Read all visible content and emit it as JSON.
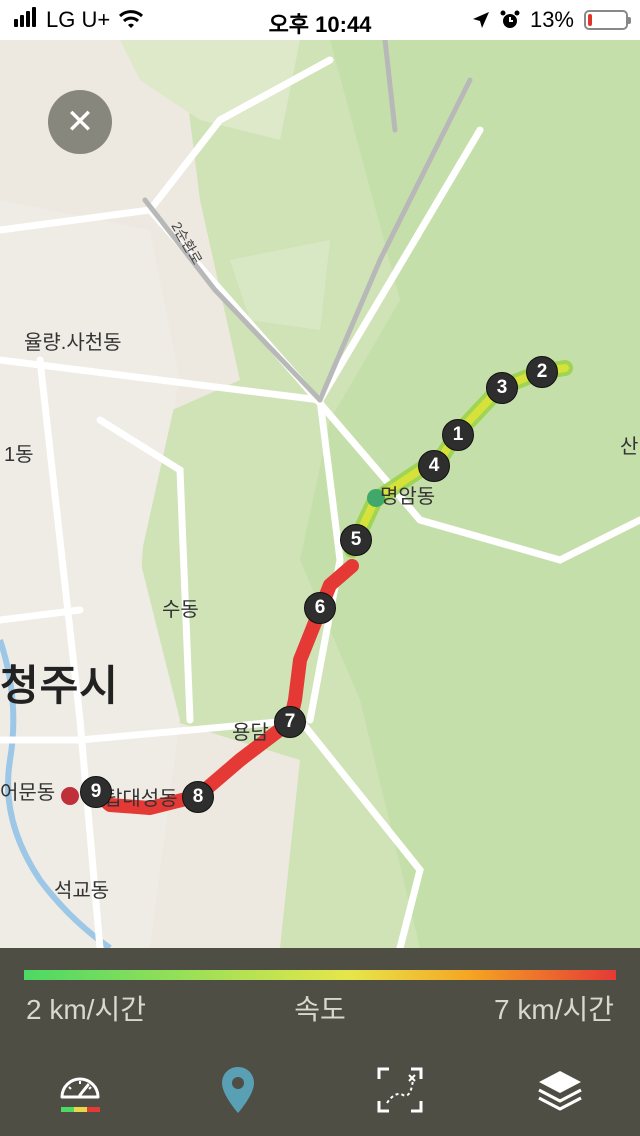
{
  "status_bar": {
    "carrier": "LG U+",
    "time": "오후 10:44",
    "battery": "13%",
    "battery_level": 0.13
  },
  "map": {
    "labels": {
      "ryulryang": "율량.사천동",
      "il_dong": "1동",
      "su_dong": "수동",
      "cheongju": "청주시",
      "yongdam": "용담",
      "munyo": "어문동",
      "seokgyo": "석교동",
      "beommdong": "명암동",
      "daeseong": "탑대성동",
      "san": "산",
      "road": "2순환로"
    },
    "markers": [
      "1",
      "2",
      "3",
      "4",
      "5",
      "6",
      "7",
      "8",
      "9"
    ]
  },
  "close_button": "✕",
  "legend": {
    "min": "2 km/시간",
    "label": "속도",
    "max": "7 km/시간"
  },
  "toolbar": {
    "icons": [
      "speedometer-icon",
      "location-pin-icon",
      "map-expand-icon",
      "layers-icon"
    ],
    "colors": {
      "active_pin": "#5aa0b4",
      "icon": "#ffffff"
    }
  }
}
